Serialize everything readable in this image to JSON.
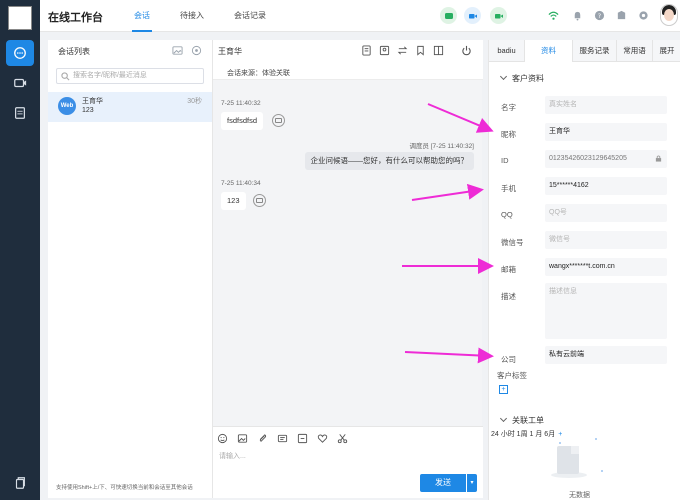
{
  "header": {
    "title": "在线工作台",
    "tabs": [
      {
        "label": "会话",
        "active": true
      },
      {
        "label": "待接入",
        "active": false
      },
      {
        "label": "会话记录",
        "active": false
      }
    ]
  },
  "conversations": {
    "title": "会话列表",
    "search_placeholder": "搜索名字/昵称/最近消息",
    "items": [
      {
        "badge": "Web",
        "name": "王育华",
        "last_message": "123",
        "time": "30秒"
      }
    ],
    "footer_tip": "支持使用Shift+上/下、可快速切换当前和会话至其他会话"
  },
  "chat": {
    "customer_name": "王育华",
    "source": "会话来源：体验关联",
    "messages": [
      {
        "time": "7-25 11:40:32",
        "text": "fsdfsdfsd",
        "from": "customer"
      },
      {
        "time": "调度员 [7-25 11:40:32]",
        "text": "企业问候语——您好，有什么可以帮助您的吗？",
        "from": "agent"
      },
      {
        "time": "7-25 11:40:34",
        "text": "123",
        "from": "customer"
      }
    ],
    "input_placeholder": "请输入...",
    "send_label": "发送"
  },
  "panel": {
    "tabs": [
      "badiu",
      "资料",
      "服务记录",
      "常用语",
      "展开"
    ],
    "active_tab": "资料",
    "section_title": "客户资料",
    "fields": [
      {
        "label": "名字",
        "value": "",
        "placeholder": "真实姓名"
      },
      {
        "label": "昵称",
        "value": "王育华",
        "placeholder": ""
      },
      {
        "label": "ID",
        "value": "0123542602312964520​5",
        "placeholder": ""
      },
      {
        "label": "手机",
        "value": "15******4162",
        "placeholder": ""
      },
      {
        "label": "QQ",
        "value": "",
        "placeholder": "QQ号"
      },
      {
        "label": "微信号",
        "value": "",
        "placeholder": "微信号"
      },
      {
        "label": "邮箱",
        "value": "wangx*******t.com.cn",
        "placeholder": ""
      },
      {
        "label": "描述",
        "value": "",
        "placeholder": "描述信息"
      },
      {
        "label": "公司",
        "value": "私有云前端",
        "placeholder": ""
      }
    ],
    "tags_label": "客户标签",
    "tags_add": "+",
    "tickets_title": "关联工单",
    "ticket_filter": "24 小时 1周 1 月 6月",
    "empty_text": "无数据"
  },
  "colors": {
    "accent": "#1e88e5",
    "rail": "#1f2d3d",
    "annotation": "#ee2bd6"
  }
}
